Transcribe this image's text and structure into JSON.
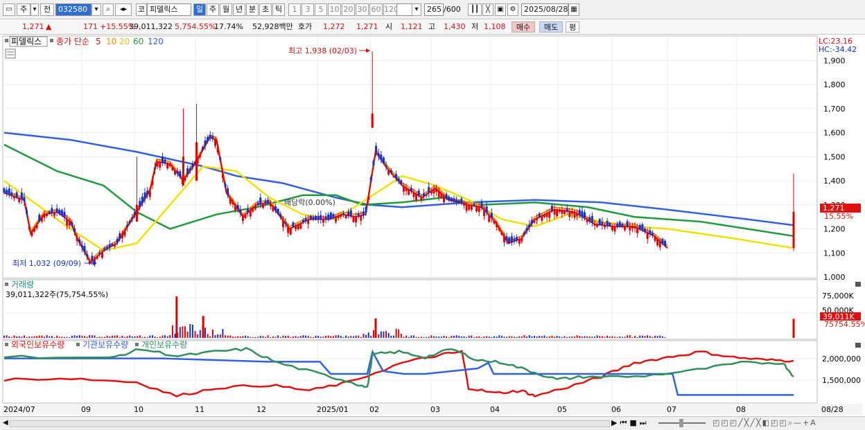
{
  "toolbar": {
    "market": "주",
    "prev": "전",
    "code": "032580",
    "name": "피델릭스",
    "kind": "코",
    "periods": [
      {
        "label": "일",
        "active": true
      },
      {
        "label": "주"
      },
      {
        "label": "월"
      },
      {
        "label": "년"
      },
      {
        "label": "분"
      },
      {
        "label": "초"
      },
      {
        "label": "틱"
      }
    ],
    "intervals": [
      "1",
      "3",
      "5",
      "10",
      "20",
      "30",
      "60",
      "120"
    ],
    "count": "265",
    "count_total": "/600",
    "date": "2025/08/28"
  },
  "quote": {
    "price": "1,271",
    "up_arrow": "▲",
    "change": "171",
    "change_pct": "+15.55%",
    "volume": "39,011,322",
    "volume_pct": "5,754.55%",
    "turnover": "17.74%",
    "amount": "52,928백만",
    "hoga_label": "호가",
    "hoga_ask": "1,272",
    "hoga_bid": "1,271",
    "open_label": "시",
    "open": "1,121",
    "high_label": "고",
    "high": "1,430",
    "low_label": "저",
    "low": "1,108",
    "buy": "매수",
    "sell": "매도",
    "flat": "평"
  },
  "price_pane": {
    "legend_name": "피델릭스",
    "legend_ma_label": "종가 단순",
    "ma_periods": [
      "5",
      "10",
      "20",
      "60",
      "120"
    ],
    "lc": "LC:23.16",
    "hc": "HC:-34.42",
    "y_ticks": [
      "1,900",
      "1,800",
      "1,700",
      "1,600",
      "1,500",
      "1,400",
      "1,300",
      "1,200",
      "1,100",
      "1,000"
    ],
    "high_annot": "최고 1,938 (02/03)",
    "low_annot": "최저 1,032 (09/09)",
    "dividend_annot": "배당락(0.00%)",
    "current_price": "1,271",
    "current_pct": "15.55%"
  },
  "volume_pane": {
    "title": "거래량",
    "summary": "39,011,322주(75,754.55%)",
    "y_ticks": [
      "75,000K",
      "50,000K"
    ],
    "current": "39,011K",
    "current_pct": "75754.55%"
  },
  "holdings_pane": {
    "legend": [
      "외국인보유수량",
      "기관보유수량",
      "개인보유수량"
    ],
    "y_ticks": [
      "2,000,000",
      "1,500,000"
    ]
  },
  "x_labels": [
    "2024/07",
    "09",
    "10",
    "11",
    "12",
    "2025/01",
    "02",
    "03",
    "04",
    "05",
    "06",
    "07",
    "08",
    "08/28"
  ],
  "colors": {
    "ma5": "#e00000",
    "ma10": "#f08c00",
    "ma20": "#f0e000",
    "ma60": "#1f9a3a",
    "ma120": "#3060e0",
    "up": "#e00000",
    "down": "#1030d0",
    "foreign": "#e01010",
    "inst": "#3060e0",
    "indiv": "#2f8f5a"
  },
  "chart_data": {
    "type": "candlestick",
    "x_range": [
      "2024/07",
      "2025/08/28"
    ],
    "ylim": [
      1000,
      1950
    ],
    "high": {
      "value": 1938,
      "date": "02/03"
    },
    "low": {
      "value": 1032,
      "date": "09/09"
    },
    "last": {
      "open": 1121,
      "high": 1430,
      "low": 1108,
      "close": 1271
    },
    "close_trace": [
      [
        0,
        1350
      ],
      [
        0.03,
        1320
      ],
      [
        0.04,
        1180
      ],
      [
        0.06,
        1260
      ],
      [
        0.08,
        1270
      ],
      [
        0.1,
        1230
      ],
      [
        0.11,
        1160
      ],
      [
        0.13,
        1060
      ],
      [
        0.15,
        1110
      ],
      [
        0.17,
        1140
      ],
      [
        0.2,
        1270
      ],
      [
        0.22,
        1360
      ],
      [
        0.23,
        1480
      ],
      [
        0.25,
        1470
      ],
      [
        0.27,
        1400
      ],
      [
        0.29,
        1480
      ],
      [
        0.31,
        1580
      ],
      [
        0.32,
        1570
      ],
      [
        0.335,
        1350
      ],
      [
        0.36,
        1250
      ],
      [
        0.38,
        1300
      ],
      [
        0.4,
        1310
      ],
      [
        0.43,
        1200
      ],
      [
        0.46,
        1240
      ],
      [
        0.49,
        1240
      ],
      [
        0.51,
        1260
      ],
      [
        0.53,
        1250
      ],
      [
        0.545,
        1260
      ],
      [
        0.56,
        1520
      ],
      [
        0.575,
        1460
      ],
      [
        0.6,
        1380
      ],
      [
        0.63,
        1330
      ],
      [
        0.65,
        1370
      ],
      [
        0.67,
        1320
      ],
      [
        0.7,
        1300
      ],
      [
        0.72,
        1290
      ],
      [
        0.74,
        1230
      ],
      [
        0.76,
        1140
      ],
      [
        0.78,
        1160
      ],
      [
        0.8,
        1240
      ],
      [
        0.83,
        1280
      ],
      [
        0.86,
        1270
      ],
      [
        0.89,
        1220
      ],
      [
        0.92,
        1210
      ],
      [
        0.95,
        1210
      ],
      [
        0.98,
        1170
      ],
      [
        1.0,
        1120
      ]
    ],
    "ma120_trace": [
      [
        0,
        1600
      ],
      [
        0.1,
        1570
      ],
      [
        0.2,
        1520
      ],
      [
        0.3,
        1460
      ],
      [
        0.35,
        1420
      ],
      [
        0.42,
        1390
      ],
      [
        0.5,
        1330
      ],
      [
        0.55,
        1300
      ],
      [
        0.6,
        1290
      ],
      [
        0.7,
        1310
      ],
      [
        0.8,
        1320
      ],
      [
        0.9,
        1310
      ],
      [
        1.0,
        1280
      ],
      [
        1.12,
        1240
      ],
      [
        1.19,
        1215
      ]
    ],
    "ma60_trace": [
      [
        0,
        1550
      ],
      [
        0.08,
        1440
      ],
      [
        0.15,
        1380
      ],
      [
        0.2,
        1270
      ],
      [
        0.25,
        1200
      ],
      [
        0.32,
        1260
      ],
      [
        0.38,
        1290
      ],
      [
        0.45,
        1340
      ],
      [
        0.5,
        1340
      ],
      [
        0.54,
        1300
      ],
      [
        0.6,
        1310
      ],
      [
        0.66,
        1330
      ],
      [
        0.72,
        1300
      ],
      [
        0.8,
        1310
      ],
      [
        0.88,
        1290
      ],
      [
        0.95,
        1250
      ],
      [
        1.05,
        1230
      ],
      [
        1.12,
        1200
      ],
      [
        1.19,
        1170
      ]
    ],
    "ma20_trace": [
      [
        0,
        1400
      ],
      [
        0.05,
        1300
      ],
      [
        0.1,
        1200
      ],
      [
        0.15,
        1110
      ],
      [
        0.2,
        1140
      ],
      [
        0.25,
        1300
      ],
      [
        0.3,
        1460
      ],
      [
        0.35,
        1440
      ],
      [
        0.4,
        1330
      ],
      [
        0.45,
        1260
      ],
      [
        0.5,
        1240
      ],
      [
        0.55,
        1330
      ],
      [
        0.6,
        1420
      ],
      [
        0.65,
        1380
      ],
      [
        0.7,
        1320
      ],
      [
        0.75,
        1240
      ],
      [
        0.8,
        1210
      ],
      [
        0.85,
        1260
      ],
      [
        0.9,
        1230
      ],
      [
        0.95,
        1210
      ],
      [
        1.0,
        1200
      ],
      [
        1.1,
        1160
      ],
      [
        1.19,
        1120
      ]
    ],
    "volume_spikes": [
      [
        0.26,
        85
      ],
      [
        0.3,
        45
      ],
      [
        0.56,
        40
      ],
      [
        1.19,
        39
      ]
    ],
    "foreign_trace": [
      [
        0,
        0.4
      ],
      [
        0.1,
        0.42
      ],
      [
        0.2,
        0.35
      ],
      [
        0.26,
        0.1
      ],
      [
        0.32,
        0.25
      ],
      [
        0.4,
        0.3
      ],
      [
        0.46,
        0.2
      ],
      [
        0.52,
        0.35
      ],
      [
        0.6,
        0.7
      ],
      [
        0.66,
        0.85
      ],
      [
        0.69,
        0.9
      ],
      [
        0.7,
        0.25
      ],
      [
        0.74,
        0.15
      ],
      [
        0.78,
        0.2
      ],
      [
        0.8,
        0.1
      ],
      [
        0.86,
        0.3
      ],
      [
        0.9,
        0.45
      ],
      [
        0.95,
        0.7
      ],
      [
        1.0,
        0.8
      ],
      [
        1.05,
        0.9
      ],
      [
        1.1,
        0.8
      ],
      [
        1.15,
        0.75
      ],
      [
        1.19,
        0.74
      ]
    ],
    "inst_trace": [
      [
        0,
        0.78
      ],
      [
        0.3,
        0.78
      ],
      [
        0.5,
        0.72
      ],
      [
        0.6,
        0.72
      ],
      [
        0.62,
        0.5
      ],
      [
        0.69,
        0.5
      ],
      [
        0.7,
        0.9
      ],
      [
        0.72,
        0.55
      ],
      [
        0.76,
        0.5
      ],
      [
        0.8,
        0.5
      ],
      [
        0.9,
        0.6
      ],
      [
        0.92,
        0.7
      ],
      [
        0.93,
        0.5
      ],
      [
        1.0,
        0.5
      ],
      [
        1.1,
        0.5
      ],
      [
        1.27,
        0.5
      ],
      [
        1.28,
        0.12
      ],
      [
        1.5,
        0.12
      ]
    ],
    "indiv_trace": [
      [
        0,
        0.82
      ],
      [
        0.2,
        0.78
      ],
      [
        0.26,
        0.95
      ],
      [
        0.33,
        0.82
      ],
      [
        0.4,
        0.9
      ],
      [
        0.46,
        0.95
      ],
      [
        0.52,
        0.7
      ],
      [
        0.6,
        0.5
      ],
      [
        0.66,
        0.35
      ],
      [
        0.69,
        0.25
      ],
      [
        0.7,
        0.85
      ],
      [
        0.75,
        0.9
      ],
      [
        0.8,
        0.8
      ],
      [
        0.85,
        0.95
      ],
      [
        0.9,
        0.75
      ],
      [
        0.95,
        0.7
      ],
      [
        1.0,
        0.55
      ],
      [
        1.05,
        0.4
      ],
      [
        1.1,
        0.45
      ],
      [
        1.2,
        0.45
      ],
      [
        1.3,
        0.55
      ],
      [
        1.4,
        0.7
      ],
      [
        1.48,
        0.7
      ],
      [
        1.5,
        0.45
      ]
    ]
  }
}
